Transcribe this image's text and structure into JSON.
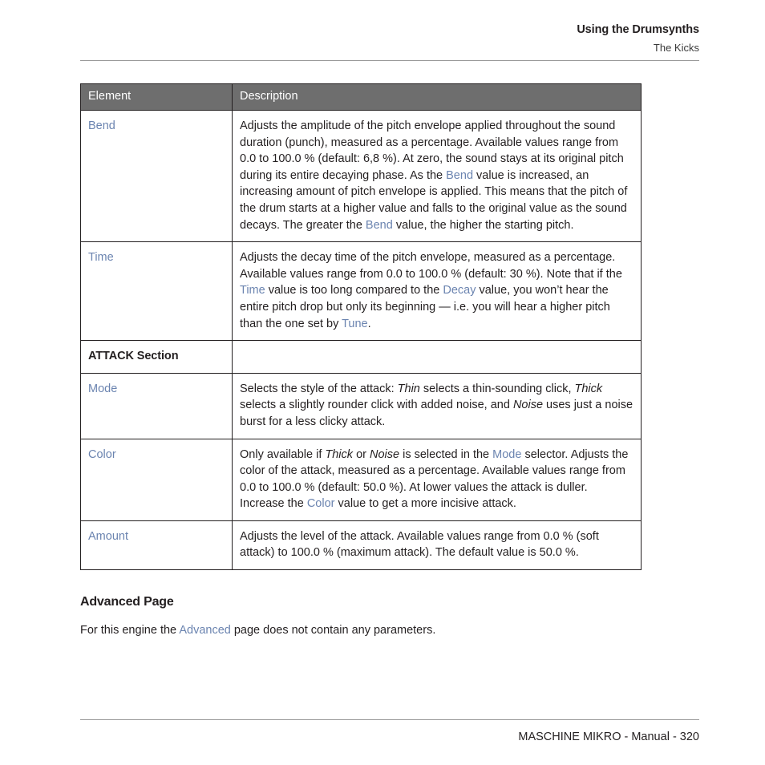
{
  "header": {
    "title": "Using the Drumsynths",
    "subtitle": "The Kicks"
  },
  "table": {
    "columns": [
      "Element",
      "Description"
    ],
    "rows": [
      {
        "element": "Bend",
        "element_style": "xref",
        "description_segments": [
          {
            "t": "Adjusts the amplitude of the pitch envelope applied throughout the sound duration (punch), measured as a percentage. Available values range from 0.0 to 100.0 % (default: 6,8 %). At zero, the sound stays at its original pitch during its entire decaying phase. As the ",
            "s": "plain"
          },
          {
            "t": "Bend",
            "s": "xref"
          },
          {
            "t": " value is increased, an increasing amount of pitch envelope is applied. This means that the pitch of the drum starts at a higher value and falls to the original value as the sound decays. The greater the ",
            "s": "plain"
          },
          {
            "t": "Bend",
            "s": "xref"
          },
          {
            "t": " value, the higher the starting pitch.",
            "s": "plain"
          }
        ]
      },
      {
        "element": "Time",
        "element_style": "xref",
        "description_segments": [
          {
            "t": "Adjusts the decay time of the pitch envelope, measured as a percentage. Available values range from 0.0 to 100.0 % (default: 30 %). Note that if the ",
            "s": "plain"
          },
          {
            "t": "Time",
            "s": "xref"
          },
          {
            "t": " value is too long compared to the ",
            "s": "plain"
          },
          {
            "t": "Decay",
            "s": "xref"
          },
          {
            "t": " value, you won’t hear the entire pitch drop but only its beginning — i.e. you will hear a higher pitch than the one set by ",
            "s": "plain"
          },
          {
            "t": "Tune",
            "s": "xref"
          },
          {
            "t": ".",
            "s": "plain"
          }
        ]
      },
      {
        "element": "ATTACK Section",
        "element_style": "section",
        "description_segments": []
      },
      {
        "element": "Mode",
        "element_style": "xref",
        "description_segments": [
          {
            "t": "Selects the style of the attack: ",
            "s": "plain"
          },
          {
            "t": "Thin",
            "s": "italic"
          },
          {
            "t": " selects a thin-sounding click, ",
            "s": "plain"
          },
          {
            "t": "Thick",
            "s": "italic"
          },
          {
            "t": " selects a slightly rounder click with added noise, and ",
            "s": "plain"
          },
          {
            "t": "Noise",
            "s": "italic"
          },
          {
            "t": " uses just a noise burst for a less clicky attack.",
            "s": "plain"
          }
        ]
      },
      {
        "element": "Color",
        "element_style": "xref",
        "description_segments": [
          {
            "t": "Only available if ",
            "s": "plain"
          },
          {
            "t": "Thick",
            "s": "italic"
          },
          {
            "t": " or ",
            "s": "plain"
          },
          {
            "t": "Noise",
            "s": "italic"
          },
          {
            "t": " is selected in the ",
            "s": "plain"
          },
          {
            "t": "Mode",
            "s": "xref"
          },
          {
            "t": " selector. Adjusts the color of the attack, measured as a percentage. Available values range from 0.0 to 100.0 % (default: 50.0 %). At lower values the attack is duller. Increase the ",
            "s": "plain"
          },
          {
            "t": "Color",
            "s": "xref"
          },
          {
            "t": " value to get a more incisive attack.",
            "s": "plain"
          }
        ]
      },
      {
        "element": "Amount",
        "element_style": "xref",
        "description_segments": [
          {
            "t": "Adjusts the level of the attack. Available values range from 0.0 % (soft attack) to 100.0 % (maximum attack). The default value is 50.0 %.",
            "s": "plain"
          }
        ]
      }
    ]
  },
  "advanced_section": {
    "heading": "Advanced Page",
    "paragraph_segments": [
      {
        "t": "For this engine the ",
        "s": "plain"
      },
      {
        "t": "Advanced",
        "s": "xref"
      },
      {
        "t": " page does not contain any parameters.",
        "s": "plain"
      }
    ]
  },
  "footer": {
    "text": "MASCHINE MIKRO - Manual - 320"
  },
  "colors": {
    "xref_blue": "#6b84b0",
    "header_gray": "#6e6e6e",
    "body_text": "#231f20",
    "rule_gray": "#9a9a9a"
  }
}
